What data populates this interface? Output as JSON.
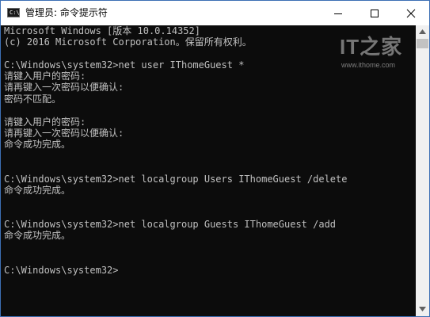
{
  "window": {
    "title": "管理员: 命令提示符",
    "icon": "console-icon",
    "icon_text": "C:\\",
    "controls": [
      "minimize-icon",
      "maximize-icon",
      "close-icon"
    ],
    "accent": "#3c6fb4"
  },
  "console": {
    "background": "#0c0c0c",
    "foreground": "#c0c0c0",
    "lines": [
      "Microsoft Windows [版本 10.0.14352]",
      "(c) 2016 Microsoft Corporation。保留所有权利。",
      "",
      "C:\\Windows\\system32>net user IThomeGuest *",
      "请键入用户的密码:",
      "请再键入一次密码以便确认:",
      "密码不匹配。",
      "",
      "请键入用户的密码:",
      "请再键入一次密码以便确认:",
      "命令成功完成。",
      "",
      "",
      "C:\\Windows\\system32>net localgroup Users IThomeGuest /delete",
      "命令成功完成。",
      "",
      "",
      "C:\\Windows\\system32>net localgroup Guests IThomeGuest /add",
      "命令成功完成。",
      "",
      "",
      "C:\\Windows\\system32>"
    ]
  },
  "watermark": {
    "logo": "IT之家",
    "url": "www.ithome.com"
  }
}
